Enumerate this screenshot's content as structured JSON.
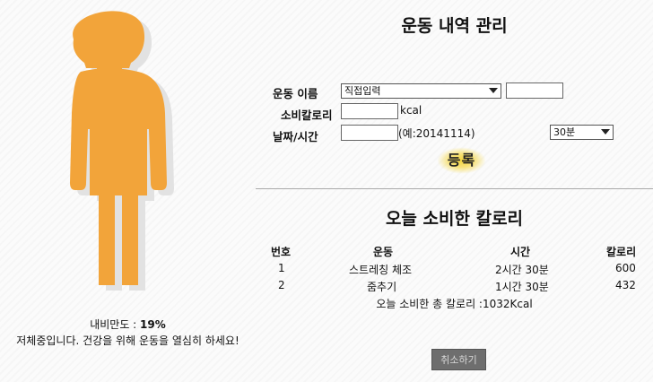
{
  "status": {
    "obesity_label": "내비만도 : ",
    "obesity_value": "19%",
    "message": "저체중입니다. 건강을 위해 운동을 열심히 하세요!"
  },
  "form": {
    "title": "운동 내역 관리",
    "exercise_label": "운동 이름",
    "exercise_select": "직접입력",
    "exercise_input": "",
    "calorie_label": "소비칼로리",
    "calorie_input": "",
    "calorie_unit": "kcal",
    "datetime_label": "날짜/시간",
    "date_input": "",
    "date_hint": "(예:20141114)",
    "duration_select": "30분",
    "register_button": "등록"
  },
  "today": {
    "title": "오늘 소비한 칼로리",
    "columns": [
      "번호",
      "운동",
      "시간",
      "칼로리"
    ],
    "rows": [
      [
        "1",
        "스트레칭 체조",
        "2시간 30분",
        "600"
      ],
      [
        "2",
        "줌추기",
        "1시간 30분",
        "432"
      ]
    ],
    "total": "오늘 소비한 총 칼로리 :1032Kcal"
  },
  "cancel_button": "취소하기",
  "colors": {
    "figure": "#f2a43a",
    "figure_shadow": "#e2e2e2",
    "register_highlight": "#f2d43e",
    "cancel_bg": "#6e6e6e"
  }
}
